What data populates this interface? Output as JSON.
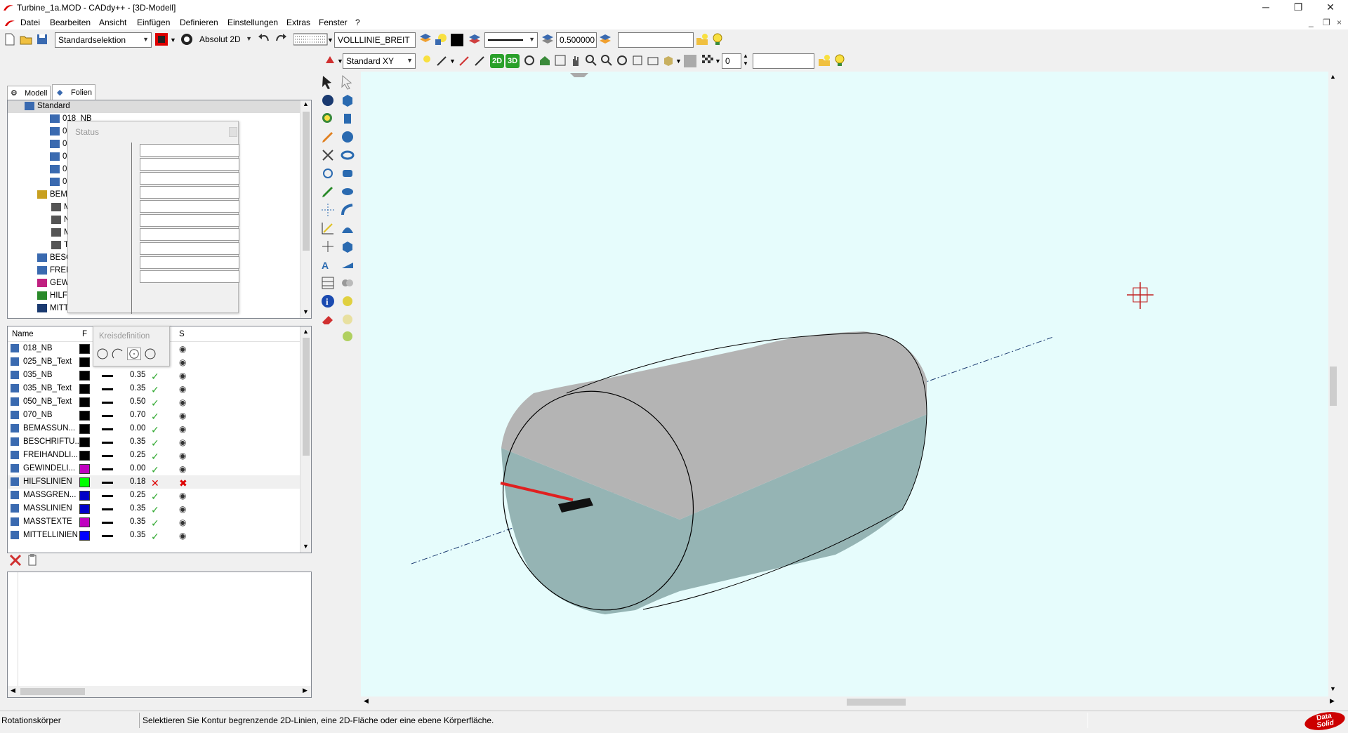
{
  "window": {
    "title": "Turbine_1a.MOD  - CADdy++ - [3D-Modell]",
    "controls": {
      "minimize": "─",
      "restore": "❐",
      "close": "✕"
    },
    "mdi_controls": {
      "minimize": "_",
      "restore": "❐",
      "close": "×"
    }
  },
  "menu": [
    "Datei",
    "Bearbeiten",
    "Ansicht",
    "Einfügen",
    "Definieren",
    "Einstellungen",
    "Extras",
    "Fenster",
    "?"
  ],
  "toolbar1": {
    "selection_mode": "Standardselektion",
    "coord_mode": "Absolut 2D",
    "line_style": "VOLLLINIE_BREIT",
    "line_width": "0.500000",
    "search_value": ""
  },
  "toolbar2": {
    "view": "Standard XY",
    "spin_value": "0",
    "field_value": "",
    "btn_2d": "2D",
    "btn_3d": "3D"
  },
  "tabs": [
    {
      "label": "Modell"
    },
    {
      "label": "Folien"
    }
  ],
  "tree": {
    "root": "Standard",
    "items": [
      {
        "label": "018_NB"
      },
      {
        "label": "025_I"
      },
      {
        "label": "035_I"
      },
      {
        "label": "035_I"
      },
      {
        "label": "050_I"
      },
      {
        "label": "070_I"
      },
      {
        "label": "BEM"
      },
      {
        "label": "M"
      },
      {
        "label": "N"
      },
      {
        "label": "M"
      },
      {
        "label": "T"
      },
      {
        "label": "BESC"
      },
      {
        "label": "FREII"
      },
      {
        "label": "GEW"
      },
      {
        "label": "HILF"
      },
      {
        "label": "MITTELLINIEN"
      }
    ]
  },
  "status_popup": {
    "caption": "Status"
  },
  "kreis_popup": {
    "caption": "Kreisdefinition"
  },
  "layer_table": {
    "headers": {
      "name": "Name",
      "f": "F",
      "s": "S"
    },
    "rows": [
      {
        "name": "018_NB",
        "color": "#000000",
        "width": "",
        "visible": true,
        "frozen": false
      },
      {
        "name": "025_NB_Text",
        "color": "#000000",
        "width": "",
        "visible": true,
        "frozen": false
      },
      {
        "name": "035_NB",
        "color": "#000000",
        "width": "0.35",
        "visible": true,
        "frozen": false
      },
      {
        "name": "035_NB_Text",
        "color": "#000000",
        "width": "0.35",
        "visible": true,
        "frozen": false
      },
      {
        "name": "050_NB_Text",
        "color": "#000000",
        "width": "0.50",
        "visible": true,
        "frozen": false
      },
      {
        "name": "070_NB",
        "color": "#000000",
        "width": "0.70",
        "visible": true,
        "frozen": false
      },
      {
        "name": "BEMASSUN...",
        "color": "#000000",
        "width": "0.00",
        "visible": true,
        "frozen": false
      },
      {
        "name": "BESCHRIFTU...",
        "color": "#000000",
        "width": "0.35",
        "visible": true,
        "frozen": false
      },
      {
        "name": "FREIHANDLI...",
        "color": "#000000",
        "width": "0.25",
        "visible": true,
        "frozen": false
      },
      {
        "name": "GEWINDELI...",
        "color": "#c000c0",
        "width": "0.00",
        "visible": true,
        "frozen": false
      },
      {
        "name": "HILFSLINIEN",
        "color": "#00ff00",
        "width": "0.18",
        "visible": false,
        "frozen": true
      },
      {
        "name": "MASSGREN...",
        "color": "#0000c8",
        "width": "0.25",
        "visible": true,
        "frozen": false
      },
      {
        "name": "MASSLINIEN",
        "color": "#0000c8",
        "width": "0.35",
        "visible": true,
        "frozen": false
      },
      {
        "name": "MASSTEXTE",
        "color": "#c000c0",
        "width": "0.35",
        "visible": true,
        "frozen": false
      },
      {
        "name": "MITTELLINIEN",
        "color": "#0000ff",
        "width": "0.35",
        "visible": true,
        "frozen": false
      }
    ]
  },
  "statusbar": {
    "mode": "Rotationskörper",
    "message": "Selektieren Sie Kontur begrenzende 2D-Linien, eine 2D-Fläche oder eine ebene Körperfläche.",
    "logo_line1": "Data",
    "logo_line2": "Solid"
  },
  "colors": {
    "viewport_bg": "#e6fcfc",
    "body_top": "#b4b4b4",
    "body_bottom": "#95b4b4",
    "accent_red": "#e02020"
  }
}
